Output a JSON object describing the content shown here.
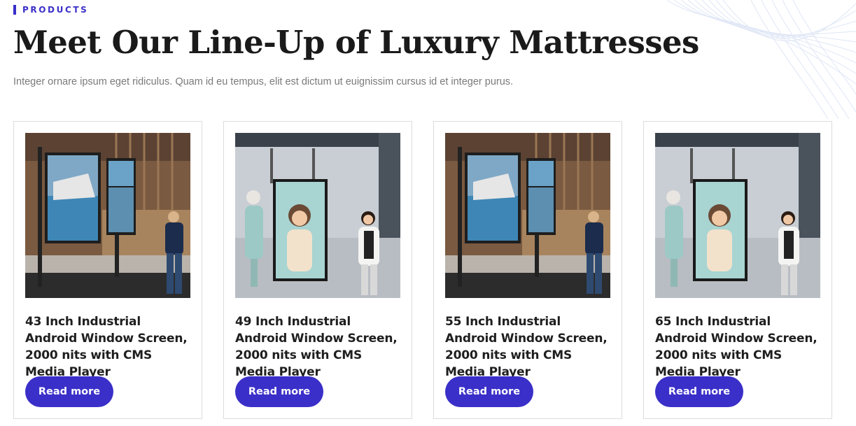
{
  "header": {
    "eyebrow": "PRODUCTS",
    "title": "Meet Our Line-Up of Luxury Mattresses",
    "subtitle": "Integer ornare ipsum eget ridiculus. Quam id eu tempus, elit est dictum ut euignissim cursus id et integer purus."
  },
  "products": [
    {
      "title": "43 Inch Industrial Android Window Screen, 2000 nits with CMS Media Player",
      "button": "Read more",
      "image": "storefront-stand-displays"
    },
    {
      "title": "49 Inch Industrial Android Window Screen, 2000 nits with CMS Media Player",
      "button": "Read more",
      "image": "hanging-window-display"
    },
    {
      "title": "55 Inch Industrial Android Window Screen, 2000 nits with CMS Media Player",
      "button": "Read more",
      "image": "storefront-stand-displays"
    },
    {
      "title": "65 Inch Industrial Android Window Screen, 2000 nits with CMS Media Player",
      "button": "Read more",
      "image": "hanging-window-display"
    }
  ],
  "colors": {
    "accent": "#3a2fc8",
    "border": "#dcdcdc",
    "muted_text": "#7a7a7a"
  }
}
